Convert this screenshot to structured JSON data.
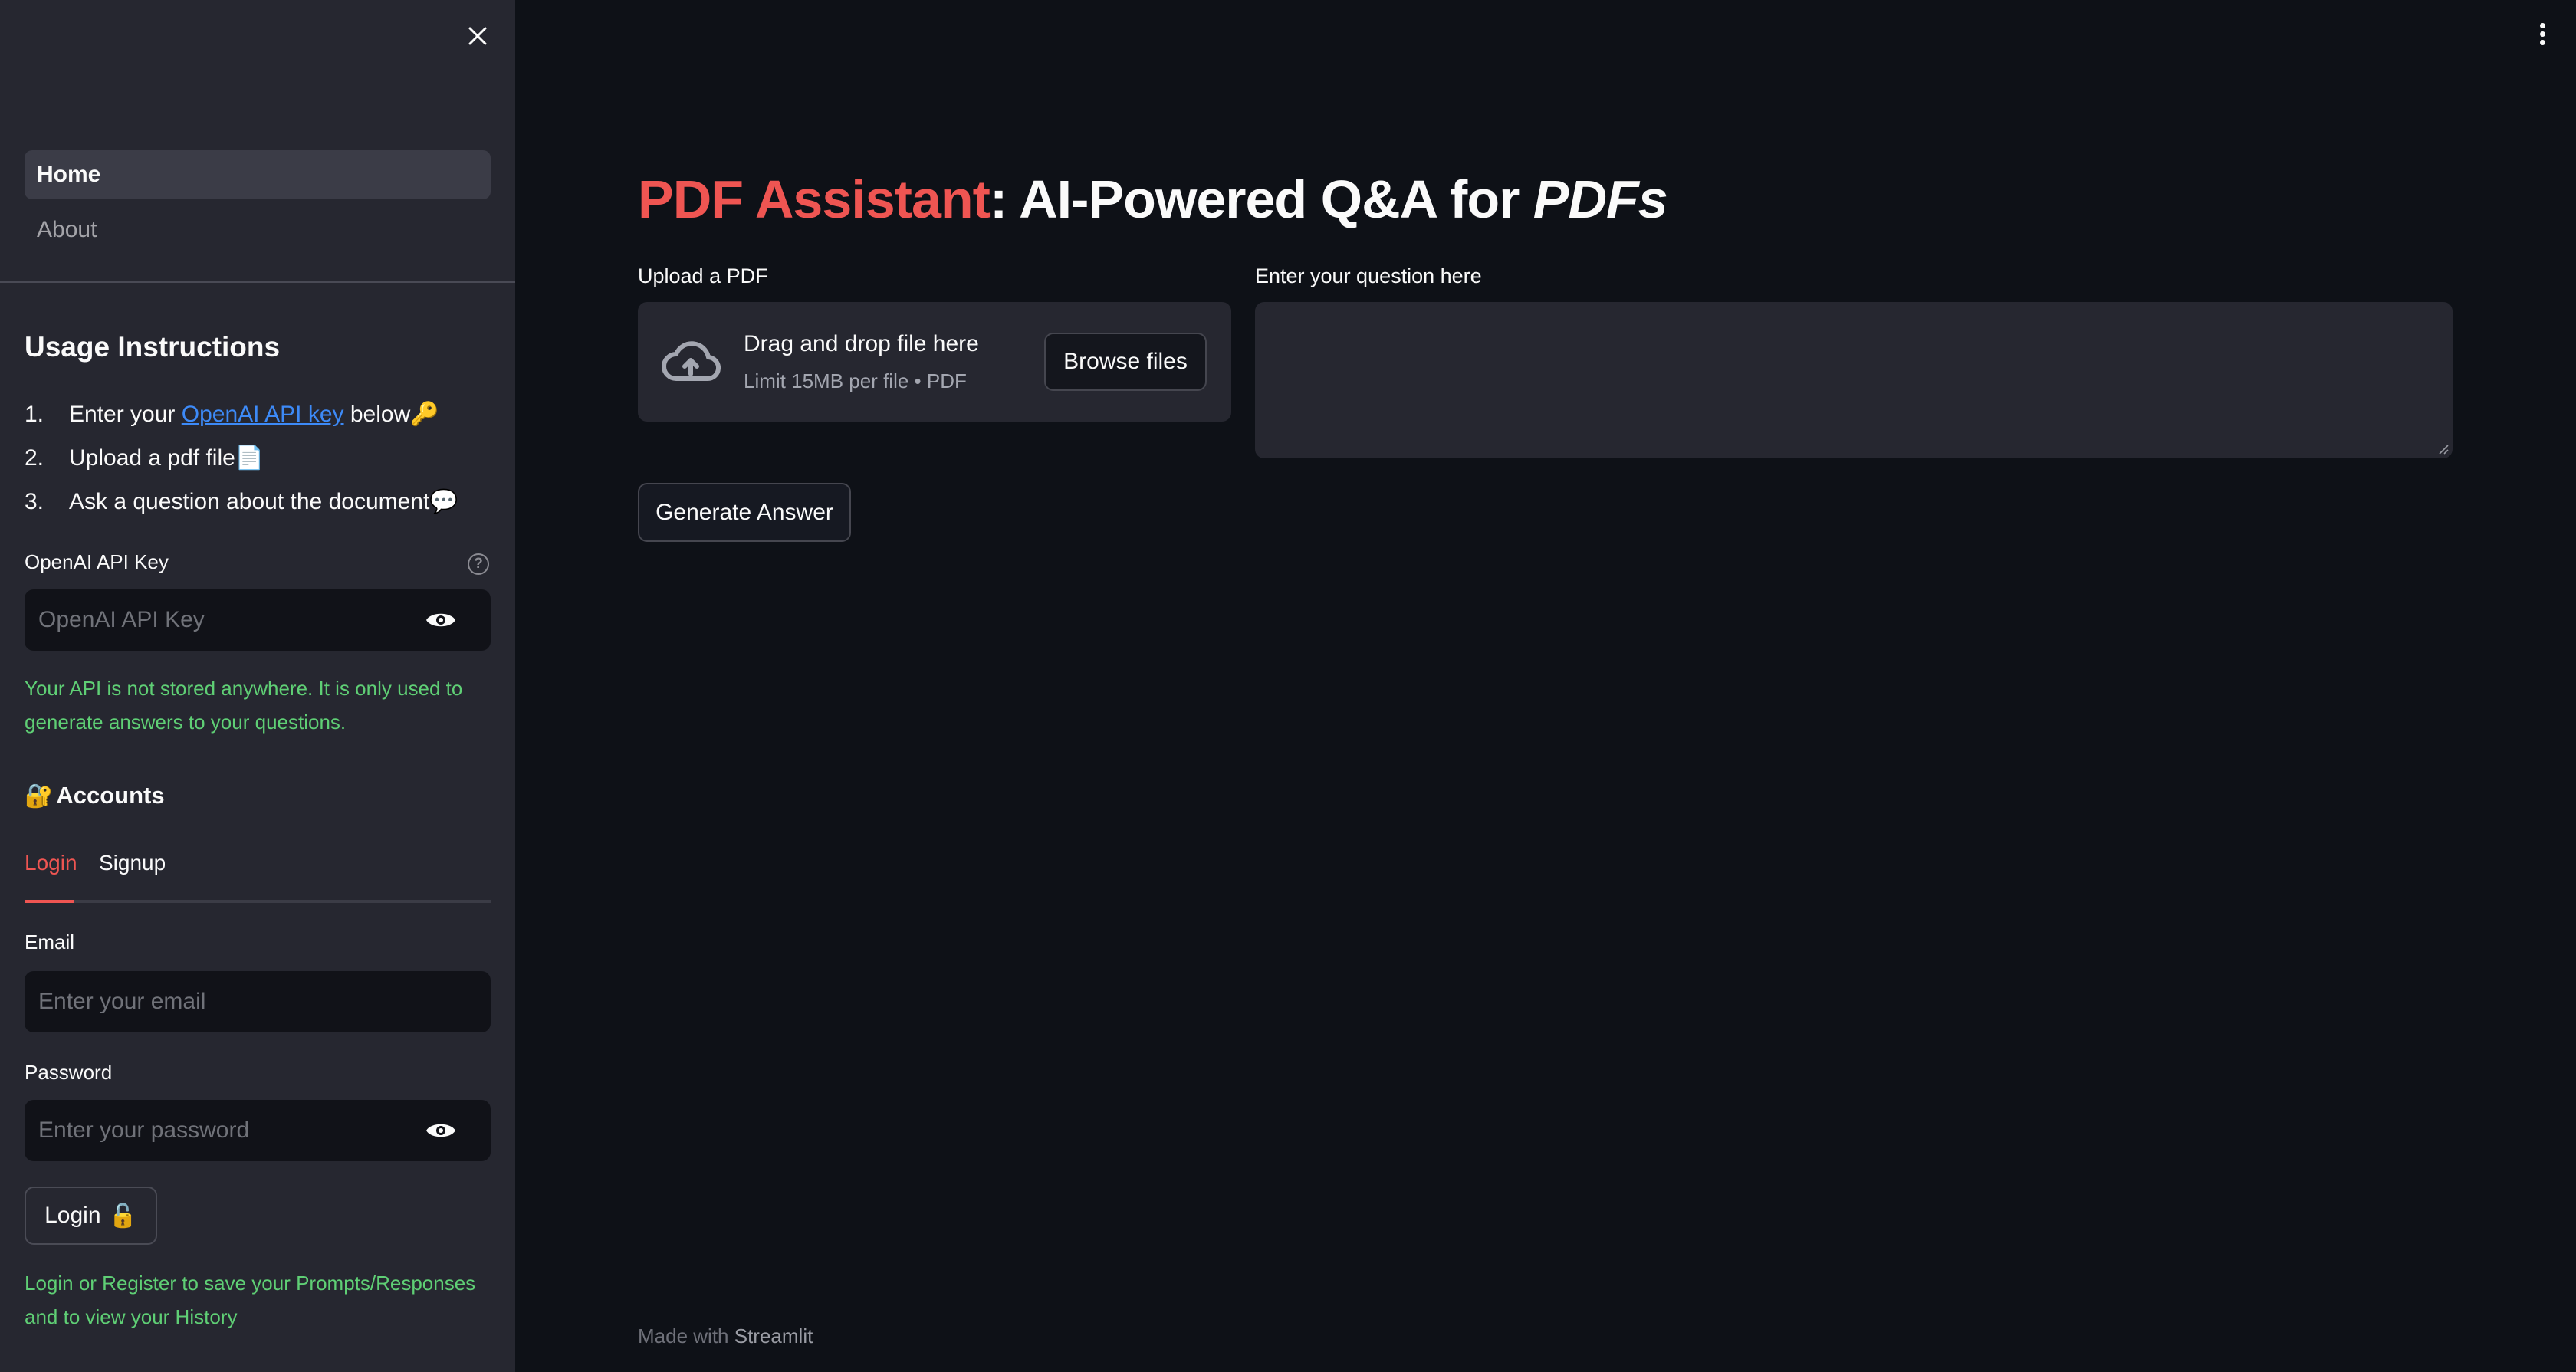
{
  "sidebar": {
    "close_icon": "close-icon",
    "nav": [
      {
        "label": "Home",
        "active": true
      },
      {
        "label": "About",
        "active": false
      }
    ],
    "usage": {
      "title": "Usage Instructions",
      "items": [
        {
          "num": "1.",
          "prefix": "Enter your ",
          "link": "OpenAI API key",
          "suffix": " below",
          "emoji": "🔑"
        },
        {
          "num": "2.",
          "prefix": "Upload a pdf file",
          "emoji": "📄"
        },
        {
          "num": "3.",
          "prefix": "Ask a question about the document",
          "emoji": "💬"
        }
      ]
    },
    "api_key": {
      "label": "OpenAI API Key",
      "placeholder": "OpenAI API Key",
      "value": "",
      "help_icon": "question-circle-icon",
      "toggle_icon": "eye-icon"
    },
    "api_note": "Your API is not stored anywhere. It is only used to generate answers to your questions.",
    "accounts": {
      "emoji": "🔐",
      "title": "Accounts",
      "tabs": [
        {
          "label": "Login",
          "active": true
        },
        {
          "label": "Signup",
          "active": false
        }
      ],
      "email": {
        "label": "Email",
        "placeholder": "Enter your email",
        "value": ""
      },
      "password": {
        "label": "Password",
        "placeholder": "Enter your password",
        "value": "",
        "toggle_icon": "eye-icon"
      },
      "login_button": {
        "label": "Login",
        "emoji": "🔓"
      },
      "note": "Login or Register to save your Prompts/Responses and to view your History"
    }
  },
  "main": {
    "menu_icon": "kebab-menu-icon",
    "title": {
      "brand": "PDF Assistant",
      "rest": ": AI-Powered Q&A for ",
      "italic": "PDFs"
    },
    "uploader": {
      "label": "Upload a PDF",
      "drop_text": "Drag and drop file here",
      "limit_text": "Limit 15MB per file • PDF",
      "browse_label": "Browse files",
      "icon": "cloud-upload-icon"
    },
    "question": {
      "label": "Enter your question here",
      "value": ""
    },
    "generate_label": "Generate Answer",
    "footer": {
      "prefix": "Made with ",
      "link": "Streamlit"
    }
  },
  "colors": {
    "accent": "#ef5552",
    "link": "#3d8af7",
    "success_text": "#5fcf75",
    "sidebar_bg": "#262730",
    "main_bg": "#0e1117"
  }
}
